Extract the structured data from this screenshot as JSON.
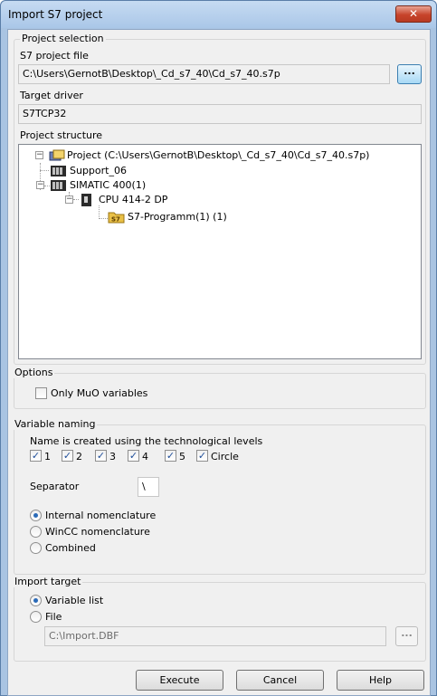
{
  "window": {
    "title": "Import S7 project",
    "close_label": "✕"
  },
  "project_selection": {
    "legend": "Project selection",
    "s7_file_label": "S7 project file",
    "s7_file_value": "C:\\Users\\GernotB\\Desktop\\_Cd_s7_40\\Cd_s7_40.s7p",
    "browse_label": "...",
    "target_driver_label": "Target driver",
    "target_driver_value": "S7TCP32",
    "structure_label": "Project structure",
    "tree": [
      {
        "label": "Project (C:\\Users\\GernotB\\Desktop\\_Cd_s7_40\\Cd_s7_40.s7p)",
        "icon": "project-icon",
        "expander": "−"
      },
      {
        "label": "Support_06",
        "icon": "station-icon"
      },
      {
        "label": "SIMATIC 400(1)",
        "icon": "station-icon",
        "expander": "−"
      },
      {
        "label": "CPU 414-2 DP",
        "icon": "cpu-icon",
        "expander": "−"
      },
      {
        "label": "S7-Programm(1) (1)",
        "icon": "s7-program-folder-icon",
        "badge": "S7"
      }
    ]
  },
  "options": {
    "legend": "Options",
    "only_muo_label": "Only MuO variables",
    "only_muo_checked": false
  },
  "variable_naming": {
    "legend": "Variable naming",
    "description": "Name is created using the technological levels",
    "levels": [
      {
        "label": "1",
        "checked": true
      },
      {
        "label": "2",
        "checked": true
      },
      {
        "label": "3",
        "checked": true
      },
      {
        "label": "4",
        "checked": true
      },
      {
        "label": "5",
        "checked": true
      },
      {
        "label": "Circle",
        "checked": true
      }
    ],
    "check_mark": "✓",
    "separator_label": "Separator",
    "separator_value": "\\",
    "nomenclature": [
      {
        "label": "Internal nomenclature",
        "selected": true
      },
      {
        "label": "WinCC nomenclature",
        "selected": false
      },
      {
        "label": "Combined",
        "selected": false
      }
    ]
  },
  "import_target": {
    "legend": "Import target",
    "options": [
      {
        "label": "Variable list",
        "selected": true
      },
      {
        "label": "File",
        "selected": false
      }
    ],
    "file_value": "C:\\Import.DBF",
    "browse_label": "..."
  },
  "buttons": {
    "execute": "Execute",
    "cancel": "Cancel",
    "help": "Help"
  }
}
